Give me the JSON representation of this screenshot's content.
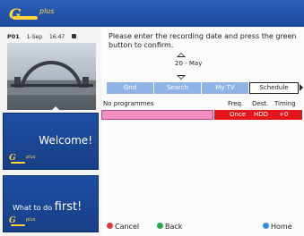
{
  "channel_info": {
    "program": "P01",
    "date": "1-Sep",
    "time": "16:47"
  },
  "message": "Please enter the recording date and press the green button to confirm.",
  "date_selector": {
    "value": "20 - May"
  },
  "tabs": [
    {
      "label": "Gnd",
      "active": false
    },
    {
      "label": "Search",
      "active": false
    },
    {
      "label": "My TV",
      "active": false
    },
    {
      "label": "Schedule",
      "active": true
    }
  ],
  "columns": {
    "programmes": "No programmes",
    "freq": "Freq.",
    "dest": "Dest.",
    "timing": "Timing"
  },
  "selected_row": {
    "freq": "Once",
    "dest": "HDD",
    "timing": "+0"
  },
  "tiles": {
    "welcome": "Welcome!",
    "what_to_do_prefix": "What to do ",
    "what_to_do_emph": "first!"
  },
  "logo": {
    "g": "G",
    "plus": "plus"
  },
  "footer": {
    "cancel": {
      "label": "Cancel",
      "color": "#e23a3a"
    },
    "back": {
      "label": "Back",
      "color": "#2aa84a"
    },
    "home": {
      "label": "Home",
      "color": "#3b8fd9"
    }
  },
  "colors": {
    "header": "#2b5fb8",
    "tab_inactive": "#8fb3e6",
    "selected_row": "#e4141b",
    "row_name": "#f08ec0",
    "logo": "#ffd23c"
  }
}
